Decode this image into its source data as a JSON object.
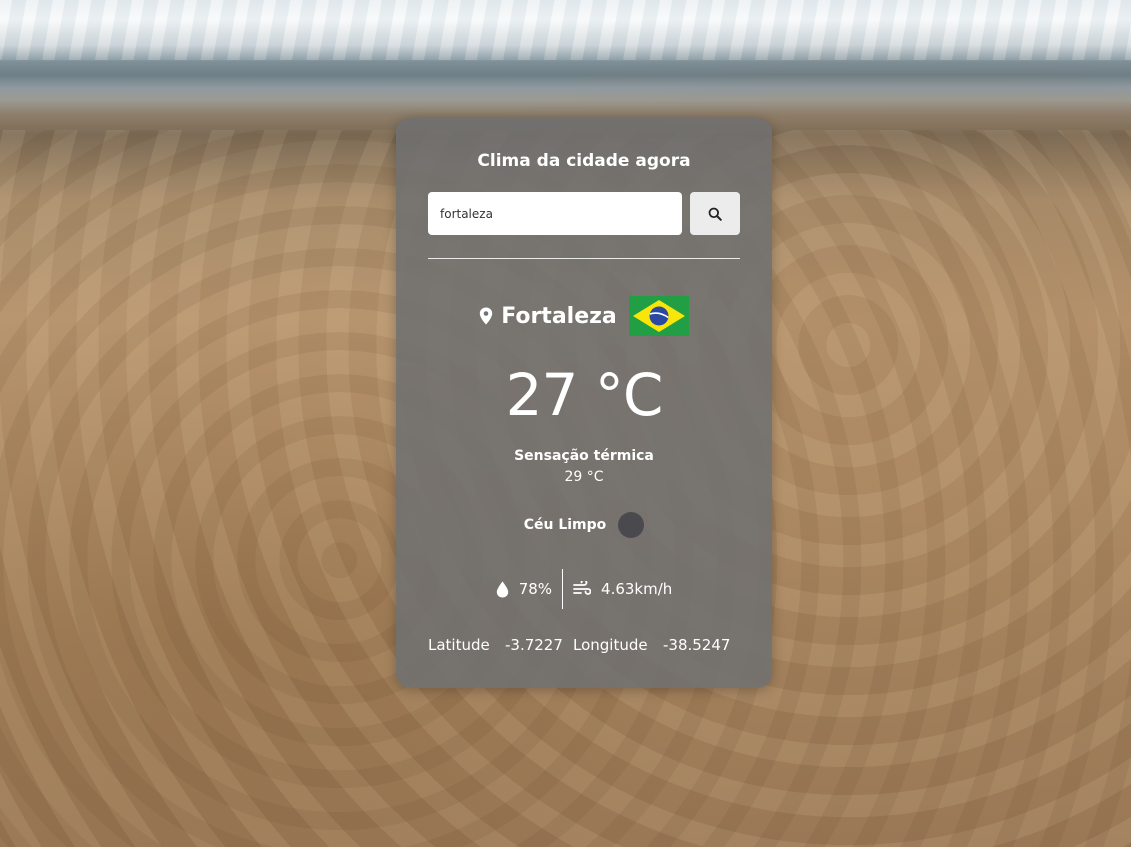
{
  "app": {
    "title": "Clima da cidade agora"
  },
  "search": {
    "value": "fortaleza",
    "button_icon": "search-icon"
  },
  "weather": {
    "city": "Fortaleza",
    "country_flag": "brazil-flag",
    "temperature": "27 °C",
    "feels_like_label": "Sensação térmica",
    "feels_like_value": "29  °C",
    "condition": "Céu Limpo",
    "condition_icon": "clear-sky-icon",
    "humidity": "78%",
    "humidity_icon": "droplet-icon",
    "wind": "4.63km/h",
    "wind_icon": "wind-icon",
    "latitude_label": "Latitude",
    "latitude_value": "-3.7227",
    "longitude_label": "Longitude",
    "longitude_value": "-38.5247"
  },
  "colors": {
    "card_background": "#707070",
    "text": "#ffffff",
    "flag_green": "#229e45",
    "flag_yellow": "#f8e509",
    "flag_blue": "#2b49a3"
  }
}
